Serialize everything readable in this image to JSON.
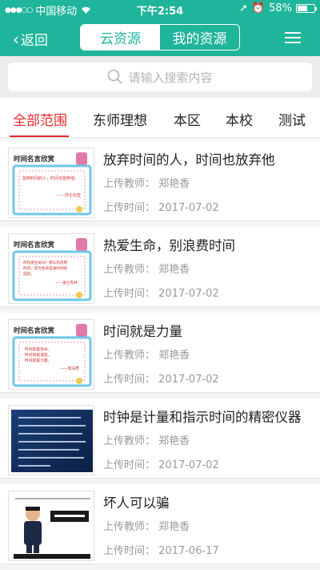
{
  "status_bar": {
    "carrier": "中国移动",
    "time": "下午2:54",
    "battery": "58%",
    "battery_level": 0.58
  },
  "nav": {
    "back_label": "返回",
    "segments": [
      "云资源",
      "我的资源"
    ],
    "active_segment": 0,
    "accent_color": "#1fb59a"
  },
  "search": {
    "placeholder": "请输入搜索内容"
  },
  "tabs": {
    "items": [
      "全部范围",
      "东师理想",
      "本区",
      "本校",
      "测试"
    ],
    "active_index": 0,
    "active_color": "#e8282b"
  },
  "list": {
    "teacher_label": "上传教师：",
    "time_label": "上传时间：",
    "items": [
      {
        "title": "放弃时间的人，时间也放弃他",
        "teacher": "郑艳香",
        "date": "2017-07-02",
        "thumb": {
          "heading": "时间名言欣赏",
          "quote_lines": [
            "放弃时间的人，时间也放弃他。"
          ],
          "author": "——莎士比亚"
        }
      },
      {
        "title": "热爱生命，别浪费时间",
        "teacher": "郑艳香",
        "date": "2017-07-02",
        "thumb": {
          "heading": "时间名言欣赏",
          "quote_lines": [
            "你热爱生命吗？那么别浪费",
            "时间，因为生命是由时间组",
            "成的。"
          ],
          "author": "——富兰克林"
        }
      },
      {
        "title": "时间就是力量",
        "teacher": "郑艳香",
        "date": "2017-07-02",
        "thumb": {
          "heading": "时间名言欣赏",
          "quote_lines": [
            "时间就是生命，",
            "时间就是速度，",
            "时间就是力量。"
          ],
          "author": "——郭沫若"
        }
      },
      {
        "title": "时钟是计量和指示时间的精密仪器",
        "teacher": "郑艳香",
        "date": "2017-07-02"
      },
      {
        "title": "坏人可以骗",
        "teacher": "郑艳香",
        "date": "2017-06-17"
      }
    ]
  }
}
